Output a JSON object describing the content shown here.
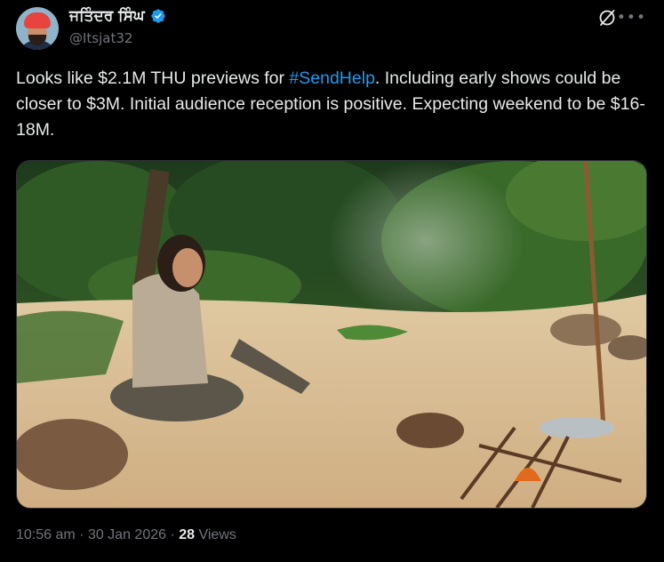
{
  "author": {
    "name": "ਜਤਿੰਦਰ ਸਿੰਘ",
    "handle": "@Itsjat32"
  },
  "tweet": {
    "text_before": "Looks like $2.1M THU previews for ",
    "hashtag": "#SendHelp",
    "text_after": ". Including early shows could be closer to $3M. Initial audience reception is positive. Expecting weekend to be $16-18M."
  },
  "meta": {
    "time": "10:56 am",
    "sep1": " · ",
    "date": "30 Jan 2026",
    "sep2": " · ",
    "views_count": "28",
    "views_label": " Views"
  },
  "colors": {
    "background": "#000000",
    "text": "#e7e9ea",
    "muted": "#71767b",
    "accent": "#1d9bf0"
  },
  "icons": {
    "verified": "verified-badge-icon",
    "grok": "grok-icon",
    "more": "more-options-icon"
  }
}
